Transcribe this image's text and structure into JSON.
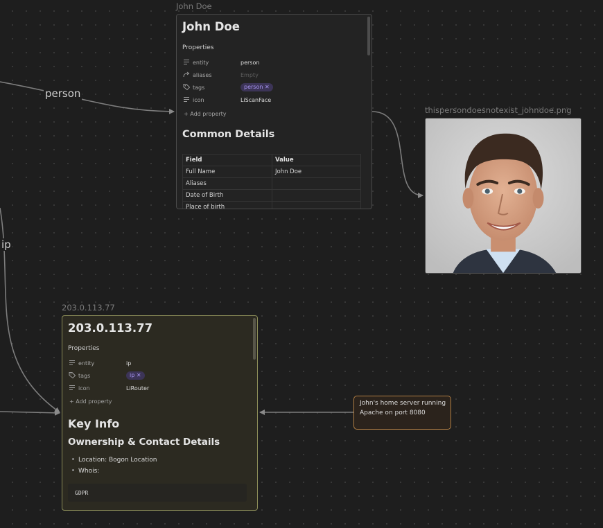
{
  "edge_labels": {
    "person": "person",
    "ip": "ip"
  },
  "john_card": {
    "node_title": "John Doe",
    "title": "John Doe",
    "properties_label": "Properties",
    "properties": [
      {
        "icon": "text-lines-icon",
        "key": "entity",
        "value": "person"
      },
      {
        "icon": "alias-arrow-icon",
        "key": "aliases",
        "value": "Empty"
      },
      {
        "icon": "tags-icon",
        "key": "tags",
        "tag": "person ✕"
      },
      {
        "icon": "text-lines-icon",
        "key": "icon",
        "value": "LiScanFace"
      }
    ],
    "add_property": "Add property",
    "section_heading": "Common Details",
    "table": {
      "headers": [
        "Field",
        "Value"
      ],
      "rows": [
        [
          "Full Name",
          "John Doe"
        ],
        [
          "Aliases",
          ""
        ],
        [
          "Date of Birth",
          ""
        ],
        [
          "Place of birth",
          ""
        ]
      ]
    }
  },
  "image_card": {
    "node_title": "thispersondoesnotexist_johndoe.png",
    "alt": "portrait photo"
  },
  "ip_card": {
    "node_title": "203.0.113.77",
    "title": "203.0.113.77",
    "properties_label": "Properties",
    "properties": [
      {
        "icon": "text-lines-icon",
        "key": "entity",
        "value": "ip"
      },
      {
        "icon": "tags-icon",
        "key": "tags",
        "tag": "ip ✕"
      },
      {
        "icon": "text-lines-icon",
        "key": "icon",
        "value": "LiRouter"
      }
    ],
    "add_property": "Add property",
    "heading1": "Key Info",
    "heading2": "Ownership & Contact Details",
    "bullets": [
      "Location: Bogon Location",
      "Whois:"
    ],
    "code": "GDPR"
  },
  "note_card": {
    "text": "John's home server running Apache on port 8080"
  },
  "colors": {
    "canvas": "#1e1e1e",
    "edge": "#8a8a8a",
    "ip_border": "#8b8c58",
    "note_border": "#b27f44",
    "tag_bg": "#3c3457",
    "tag_text": "#a996f2"
  }
}
